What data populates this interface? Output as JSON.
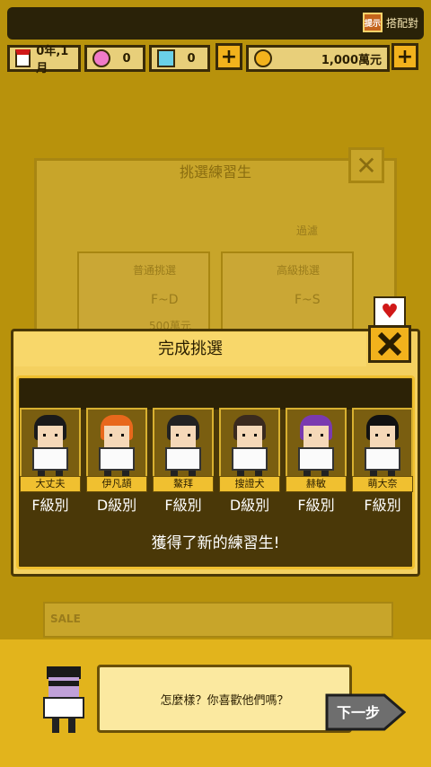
{
  "header": {
    "pair_label": "搭配對",
    "pair_icon": "提示",
    "date": "0年,1月",
    "pink_gems": "0",
    "blue_gems": "0",
    "money": "1,000萬元",
    "plus": "+"
  },
  "background_dialog": {
    "title": "挑選練習生",
    "filter_label": "過濾",
    "left_panel": {
      "label": "普通挑選",
      "grade": "F~D",
      "cost": "500萬元"
    },
    "right_panel": {
      "label": "高級挑選",
      "grade": "F~S"
    },
    "bottom_label": "SALE"
  },
  "modal": {
    "title": "完成挑選",
    "message": "獲得了新的練習生!",
    "trainees": [
      {
        "name": "大丈夫",
        "grade": "F級別",
        "hair": "#1a1a1a"
      },
      {
        "name": "伊凡頡",
        "grade": "D級別",
        "hair": "#e8681c"
      },
      {
        "name": "鰲拜",
        "grade": "F級別",
        "hair": "#222222"
      },
      {
        "name": "搜證犬",
        "grade": "D級別",
        "hair": "#3a2a1e"
      },
      {
        "name": "赫敏",
        "grade": "F級別",
        "hair": "#7a3ab0"
      },
      {
        "name": "萌大奈",
        "grade": "F級別",
        "hair": "#111111"
      }
    ]
  },
  "dialogue": {
    "text": "怎麼樣？你喜歡他們嗎？",
    "next_label": "下一步"
  },
  "colors": {
    "accent": "#f2b21c",
    "panel": "#4a3808"
  }
}
